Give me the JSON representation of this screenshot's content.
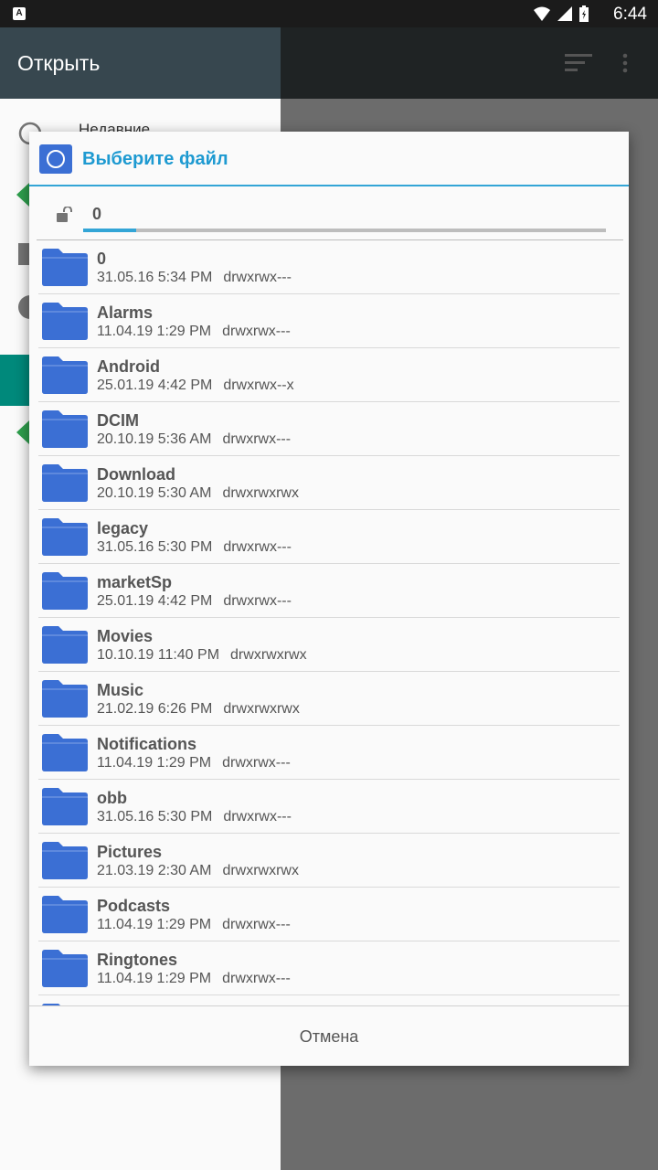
{
  "status_bar": {
    "time": "6:44",
    "notification_letter": "A"
  },
  "app": {
    "title": "Открыть",
    "peek_text": "Недавние"
  },
  "dialog": {
    "title": "Выберите файл",
    "path": "0",
    "cancel_label": "Отмена",
    "items": [
      {
        "name": "0",
        "date": "31.05.16 5:34 PM",
        "perm": "drwxrwx---"
      },
      {
        "name": "Alarms",
        "date": "11.04.19 1:29 PM",
        "perm": "drwxrwx---"
      },
      {
        "name": "Android",
        "date": "25.01.19 4:42 PM",
        "perm": "drwxrwx--x"
      },
      {
        "name": "DCIM",
        "date": "20.10.19 5:36 AM",
        "perm": "drwxrwx---"
      },
      {
        "name": "Download",
        "date": "20.10.19 5:30 AM",
        "perm": "drwxrwxrwx"
      },
      {
        "name": "legacy",
        "date": "31.05.16 5:30 PM",
        "perm": "drwxrwx---"
      },
      {
        "name": "marketSp",
        "date": "25.01.19 4:42 PM",
        "perm": "drwxrwx---"
      },
      {
        "name": "Movies",
        "date": "10.10.19 11:40 PM",
        "perm": "drwxrwxrwx"
      },
      {
        "name": "Music",
        "date": "21.02.19 6:26 PM",
        "perm": "drwxrwxrwx"
      },
      {
        "name": "Notifications",
        "date": "11.04.19 1:29 PM",
        "perm": "drwxrwx---"
      },
      {
        "name": "obb",
        "date": "31.05.16 5:30 PM",
        "perm": "drwxrwx---"
      },
      {
        "name": "Pictures",
        "date": "21.03.19 2:30 AM",
        "perm": "drwxrwxrwx"
      },
      {
        "name": "Podcasts",
        "date": "11.04.19 1:29 PM",
        "perm": "drwxrwx---"
      },
      {
        "name": "Ringtones",
        "date": "11.04.19 1:29 PM",
        "perm": "drwxrwx---"
      },
      {
        "name": "",
        "date": "",
        "perm": ""
      }
    ]
  },
  "colors": {
    "accent": "#1e9ad1",
    "folder": "#3b6fd4",
    "header": "#37474f"
  }
}
